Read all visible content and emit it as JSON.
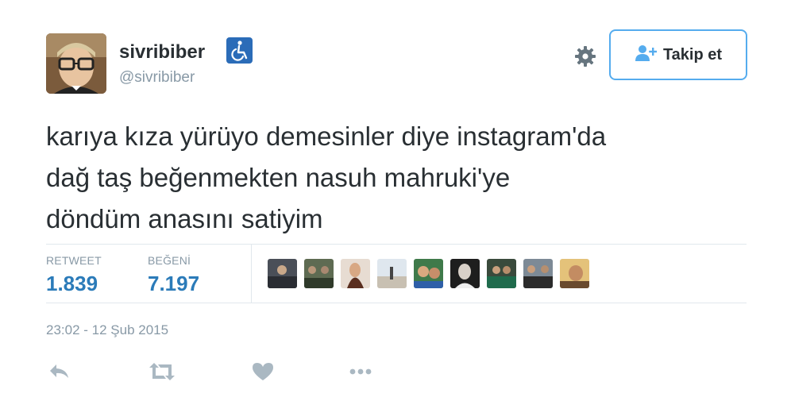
{
  "user": {
    "display_name": "sivribiber",
    "handle": "@sivribiber",
    "badge_icon": "wheelchair-icon"
  },
  "follow_button": {
    "label": "Takip et",
    "icon": "add-user-icon"
  },
  "settings_icon": "gear-icon",
  "tweet": {
    "text": "karıya kıza yürüyo demesinler diye instagram'da\ndağ taş beğenmekten nasuh mahruki'ye\ndöndüm anasını satiyim"
  },
  "stats": {
    "retweet_label": "RETWEET",
    "retweet_count": "1.839",
    "like_label": "BEĞENİ",
    "like_count": "7.197"
  },
  "likers_count": 9,
  "timestamp": "23:02 - 12 Şub 2015",
  "actions": [
    "reply-icon",
    "retweet-icon",
    "like-icon",
    "more-icon"
  ],
  "colors": {
    "accent": "#55acee",
    "stat_value": "#2b7bb9",
    "muted": "#8899a6",
    "text": "#292f33",
    "action_icon": "#aab8c2",
    "badge": "#2b6cb8"
  }
}
